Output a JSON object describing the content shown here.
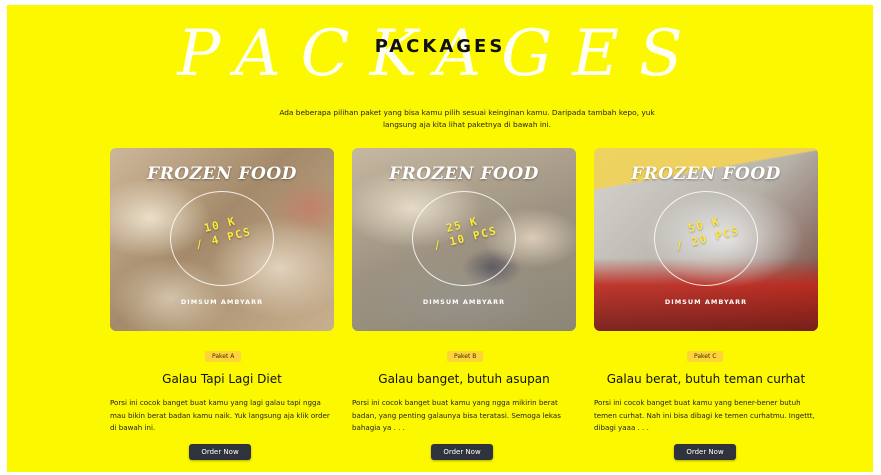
{
  "section": {
    "script_title": "PACKAGES",
    "title": "PACKAGES",
    "intro": "Ada beberapa pilihan paket yang bisa kamu pilih sesuai keinginan kamu. Daripada tambah kepo, yuk langsung aja kita lihat paketnya di bawah ini."
  },
  "colors": {
    "background": "#fcf800",
    "badge": "#ffd43a",
    "button": "#2f343c",
    "price_text": "#ffe93a"
  },
  "packages": [
    {
      "image_brand": "FROZEN FOOD",
      "image_price_line1": "10 K",
      "image_price_line2": "/ 4 PCS",
      "image_shop": "DIMSUM AMBYARR",
      "badge": "Paket A",
      "title": "Galau Tapi Lagi Diet",
      "description": "Porsi ini cocok banget buat kamu yang lagi galau tapi ngga mau bikin berat badan kamu naik. Yuk langsung aja klik order di bawah ini.",
      "button": "Order Now"
    },
    {
      "image_brand": "FROZEN FOOD",
      "image_price_line1": "25 K",
      "image_price_line2": "/ 10 PCS",
      "image_shop": "DIMSUM AMBYARR",
      "badge": "Paket B",
      "title": "Galau banget, butuh asupan",
      "description": "Porsi ini cocok banget buat kamu yang ngga mikirin berat badan, yang penting galaunya bisa teratasi. Semoga lekas bahagia ya . . .",
      "button": "Order Now"
    },
    {
      "image_brand": "FROZEN FOOD",
      "image_price_line1": "50 K",
      "image_price_line2": "/ 20 PCS",
      "image_shop": "DIMSUM AMBYARR",
      "badge": "Paket C",
      "title": "Galau berat, butuh teman curhat",
      "description": "Porsi ini cocok banget buat kamu yang bener-bener butuh temen curhat. Nah ini bisa dibagi ke temen curhatmu. Ingettt, dibagi yaaa . . .",
      "button": "Order Now"
    }
  ]
}
